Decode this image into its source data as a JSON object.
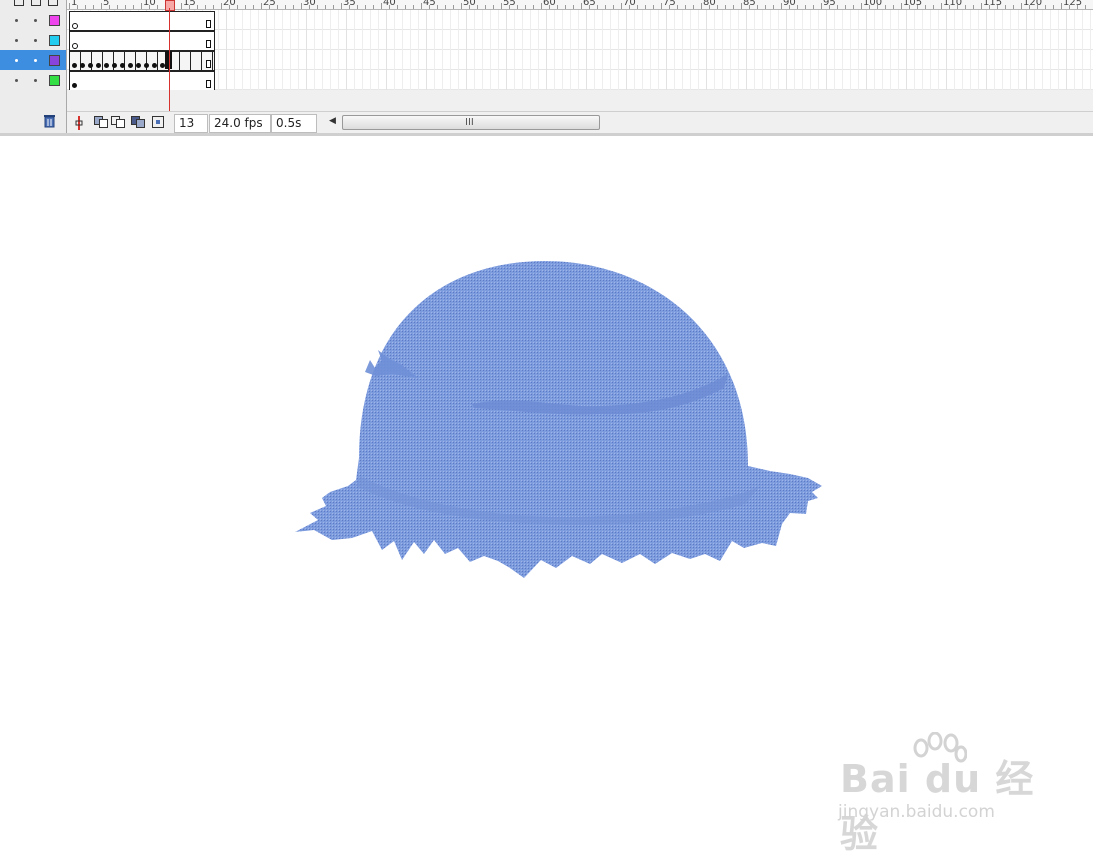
{
  "timeline": {
    "layers": [
      {
        "selected": false,
        "color": "#ee44ee"
      },
      {
        "selected": false,
        "color": "#22ccee"
      },
      {
        "selected": true,
        "color": "#8844dd"
      },
      {
        "selected": false,
        "color": "#33dd44"
      }
    ],
    "ruler_labels": [
      "1",
      "5",
      "10",
      "15",
      "20",
      "25",
      "30",
      "35",
      "40",
      "45",
      "50",
      "55",
      "60",
      "65",
      "70",
      "75",
      "80",
      "85",
      "90",
      "95",
      "100",
      "105",
      "110",
      "115",
      "120",
      "125"
    ],
    "current_frame": "13",
    "fps": "24.0 fps",
    "elapsed": "0.5s",
    "scroll_grip": "III"
  },
  "icons": {
    "delete_layer": "trash-icon",
    "onion_skin": "onion-skin-icon",
    "onion_outline": "onion-skin-outline-icon",
    "edit_multiple": "edit-multiple-frames-icon",
    "modify_markers": "modify-onion-markers-icon",
    "center_frame": "center-frame-icon"
  },
  "stage": {
    "shape_color": "#7d9cde"
  },
  "watermark": {
    "logo_text": "Bai du 经验",
    "url": "jingyan.baidu.com"
  }
}
